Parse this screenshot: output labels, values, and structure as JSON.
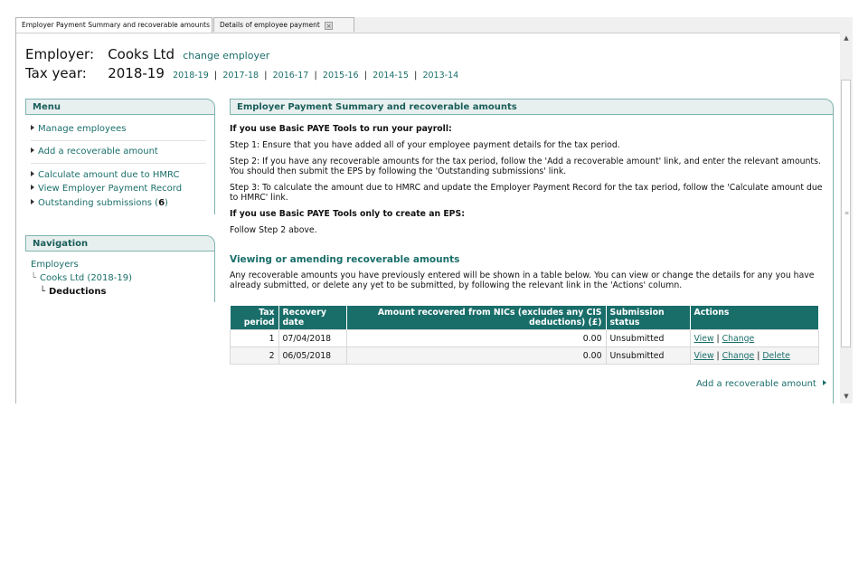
{
  "tabs": [
    {
      "label": "Employer Payment Summary and recoverable amounts"
    },
    {
      "label": "Details of employee payment"
    }
  ],
  "header": {
    "employer_label": "Employer:",
    "employer_name": "Cooks Ltd",
    "change_employer": "change employer",
    "tax_year_label": "Tax year:",
    "tax_year": "2018-19",
    "years": [
      "2018-19",
      "2017-18",
      "2016-17",
      "2015-16",
      "2014-15",
      "2013-14"
    ],
    "separator": "|"
  },
  "menu": {
    "title": "Menu",
    "items": [
      {
        "label": "Manage employees"
      },
      {
        "label": "Add a recoverable amount"
      },
      {
        "label": "Calculate amount due to HMRC"
      },
      {
        "label": "View Employer Payment Record"
      },
      {
        "label": "Outstanding submissions ("
      }
    ],
    "outstanding_count": "6",
    "outstanding_close": ")"
  },
  "navigation": {
    "title": "Navigation",
    "items": [
      {
        "label": "Employers"
      },
      {
        "label": "Cooks Ltd (2018-19)"
      },
      {
        "label": "Deductions"
      }
    ]
  },
  "main": {
    "title": "Employer Payment Summary and recoverable amounts",
    "h1": "If you use Basic PAYE Tools to run your payroll:",
    "step1": "Step 1: Ensure that you have added all of your employee payment details for the tax period.",
    "step2": "Step 2: If you have any recoverable amounts for the tax period, follow the 'Add a recoverable amount' link, and enter the relevant amounts. You should then submit the EPS by following the 'Outstanding submissions' link.",
    "step3": "Step 3: To calculate the amount due to HMRC and update the Employer Payment Record for the tax period, follow the 'Calculate amount due to HMRC' link.",
    "h2": "If you use Basic PAYE Tools only to create an EPS:",
    "follow": "Follow Step 2 above.",
    "sub_title": "Viewing or amending recoverable amounts",
    "sub_text": "Any recoverable amounts you have previously entered will be shown in a table below. You can view or change the details for any you have already submitted, or delete any yet to be submitted, by following the relevant link in the 'Actions' column.",
    "add_link": "Add a recoverable amount"
  },
  "table": {
    "headers": {
      "tax_period": "Tax period",
      "recovery_date": "Recovery date",
      "amount": "Amount recovered from NICs (excludes any CIS deductions) (£)",
      "status": "Submission status",
      "actions": "Actions"
    },
    "rows": [
      {
        "period": "1",
        "date": "07/04/2018",
        "amount": "0.00",
        "status": "Unsubmitted",
        "view": "View",
        "change": "Change"
      },
      {
        "period": "2",
        "date": "06/05/2018",
        "amount": "0.00",
        "status": "Unsubmitted",
        "view": "View",
        "change": "Change",
        "delete": "Delete"
      }
    ],
    "action_sep": "|"
  },
  "colors": {
    "accent": "#1a6e6a",
    "panel_border": "#7eb3ad",
    "panel_bg": "#e8f0ef"
  }
}
